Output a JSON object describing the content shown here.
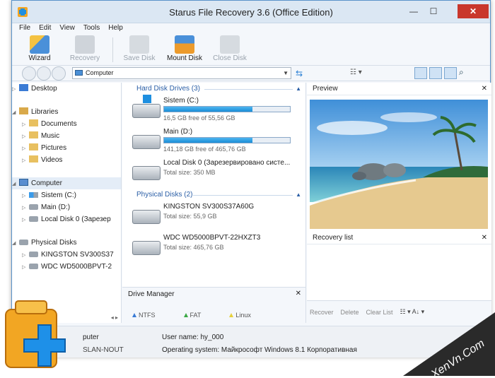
{
  "window": {
    "title": "Starus File Recovery 3.6 (Office Edition)",
    "controls": {
      "minimize": "—",
      "maximize": "☐",
      "close": "✕"
    }
  },
  "menu": [
    "File",
    "Edit",
    "View",
    "Tools",
    "Help"
  ],
  "toolbar": {
    "wizard": "Wizard",
    "recovery": "Recovery",
    "save_disk": "Save Disk",
    "mount_disk": "Mount Disk",
    "close_disk": "Close Disk"
  },
  "address": {
    "value": "Computer",
    "dropdown": "▼",
    "refresh_icon": "⇆",
    "search_icon": "⌕",
    "view_dropdown": "☷ ▾"
  },
  "tree": {
    "desktop": "Desktop",
    "libraries": "Libraries",
    "lib_items": [
      "Documents",
      "Music",
      "Pictures",
      "Videos"
    ],
    "computer": "Computer",
    "computer_items": [
      "Sistem (C:)",
      "Main (D:)",
      "Local Disk 0 (Зарезер"
    ],
    "physical": "Physical Disks",
    "physical_items": [
      "KINGSTON SV300S37",
      "WDC WD5000BPVT-2"
    ],
    "scroll": "◂ ▸"
  },
  "hard_disks": {
    "header": "Hard Disk Drives (3)",
    "drives": [
      {
        "name": "Sistem (C:)",
        "sub": "16,5 GB free of 55,56 GB",
        "used_fraction": 0.7
      },
      {
        "name": "Main (D:)",
        "sub": "141,18 GB free of 465,76 GB",
        "used_fraction": 0.7
      },
      {
        "name": "Local Disk 0 (Зарезервировано систе...",
        "sub": "Total size: 350 MB"
      }
    ]
  },
  "physical_disks": {
    "header": "Physical Disks (2)",
    "drives": [
      {
        "name": "KINGSTON SV300S37A60G",
        "sub": "Total size: 55,9 GB"
      },
      {
        "name": "WDC WD5000BPVT-22HXZT3",
        "sub": "Total size: 465,76 GB"
      }
    ]
  },
  "drive_manager": {
    "title": "Drive Manager",
    "close": "✕",
    "legend": [
      {
        "label": "NTFS",
        "color": "#3a7bd5"
      },
      {
        "label": "FAT",
        "color": "#3aa845"
      },
      {
        "label": "Linux",
        "color": "#e6d03a"
      }
    ]
  },
  "preview": {
    "title": "Preview",
    "close": "✕"
  },
  "recovery_list": {
    "title": "Recovery list",
    "close": "✕",
    "tools": [
      "Recover",
      "Delete",
      "Clear List"
    ],
    "sort_icon": "☷ ▾   A↓ ▾"
  },
  "status": {
    "computer_label": "puter",
    "computer_name": "SLAN-NOUT",
    "user": "User name: hy_000",
    "os": "Operating system: Майкрософт Windows 8.1 Корпоративная"
  },
  "watermark": {
    "text": "XenVn.Com"
  }
}
